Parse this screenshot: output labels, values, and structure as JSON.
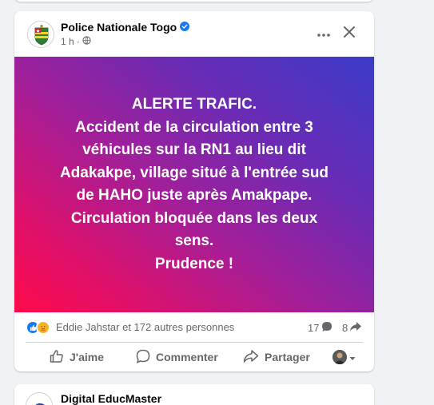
{
  "post": {
    "author": "Police Nationale Togo",
    "time": "1 h",
    "separator": "·",
    "hero_lines": [
      "ALERTE TRAFIC.",
      "Accident de la circulation entre 3",
      "véhicules sur la RN1 au lieu dit",
      "Adakakpe, village situé à l'entrée sud",
      "de HAHO juste après Amakpape.",
      "Circulation bloquée dans les deux",
      "sens.",
      "Prudence !"
    ],
    "reactions_text": "Eddie Jahstar et 172 autres personnes",
    "comments_count": "17",
    "shares_count": "8",
    "actions": {
      "like": "J'aime",
      "comment": "Commenter",
      "share": "Partager"
    }
  },
  "next_post": {
    "author": "Digital EducMaster"
  },
  "colors": {
    "accent": "#1877f2",
    "secondary_text": "#65676b",
    "gradient_start": "#ff0a4a",
    "gradient_end": "#3b3bc9"
  },
  "icons": [
    "verified-badge-icon",
    "globe-icon",
    "more-options-icon",
    "close-icon",
    "like-reaction-icon",
    "care-reaction-icon",
    "comment-bubble-icon",
    "share-arrow-icon",
    "thumb-up-icon",
    "speech-bubble-icon",
    "share-icon",
    "chevron-down-icon"
  ]
}
